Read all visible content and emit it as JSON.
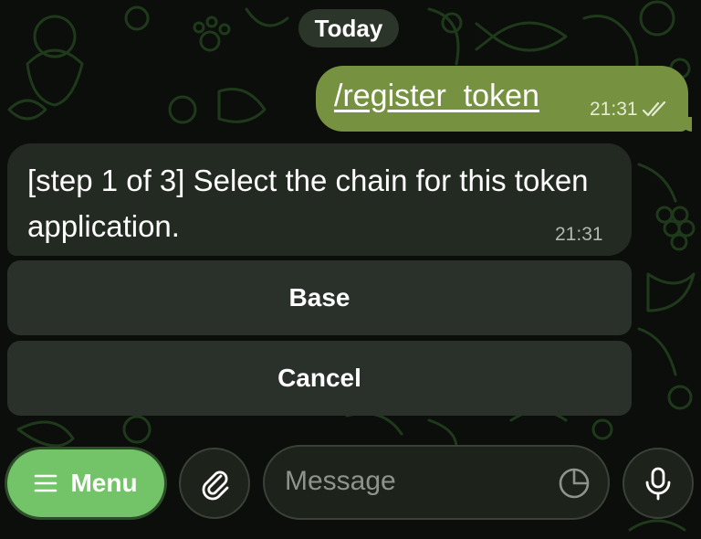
{
  "chat": {
    "date_label": "Today",
    "outgoing": {
      "text": "/register_token",
      "time": "21:31",
      "status_icon": "double-check-icon"
    },
    "incoming": {
      "text": "[step 1 of 3] Select the chain for this token application.",
      "time": "21:31"
    },
    "inline_keyboard": [
      {
        "label": "Base"
      },
      {
        "label": "Cancel"
      }
    ]
  },
  "composer": {
    "menu_label": "Menu",
    "message_placeholder": "Message",
    "icons": {
      "menu": "hamburger-icon",
      "attach": "paperclip-icon",
      "sticker": "sticker-icon",
      "voice": "microphone-icon"
    }
  },
  "colors": {
    "background": "#0c0e0b",
    "wallpaper_doodle": "#1f3a1b",
    "outgoing_bubble": "#76913f",
    "incoming_bubble": "#232a22",
    "keyboard_button": "#29312a",
    "menu_button": "#73c468"
  }
}
